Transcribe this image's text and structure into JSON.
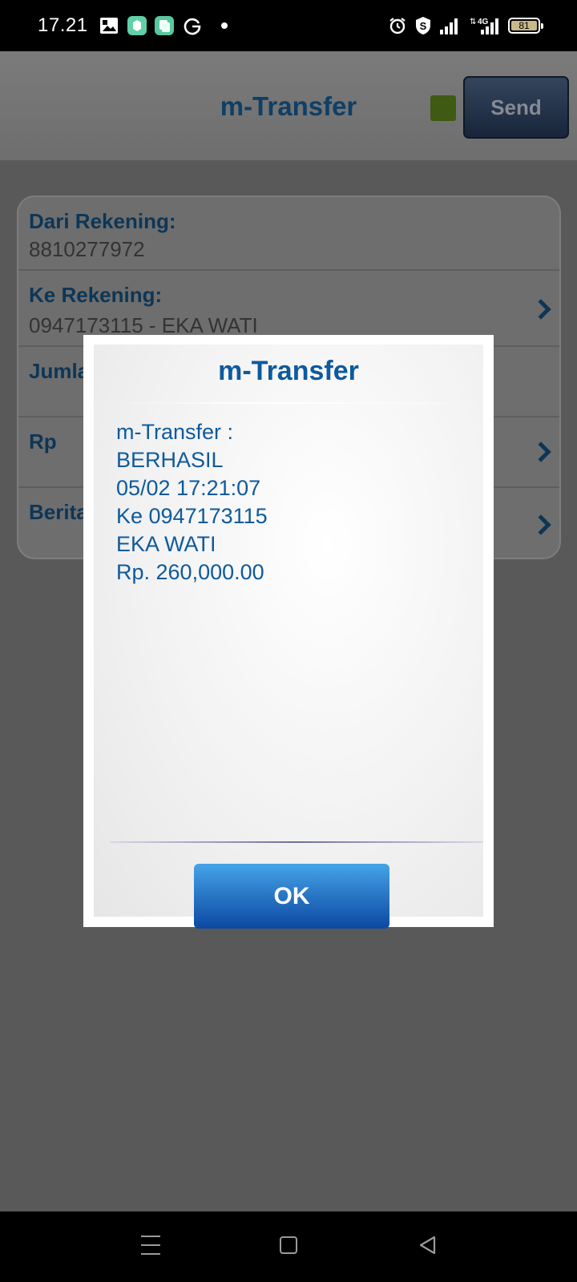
{
  "status_bar": {
    "time": "17.21",
    "network": "4G",
    "battery": "81",
    "icons": [
      "gallery-icon",
      "app-icon",
      "copy-icon",
      "g-icon",
      "dot-icon",
      "alarm-icon",
      "shield-s-icon",
      "signal-icon",
      "data-signal-icon",
      "battery-icon"
    ]
  },
  "header": {
    "title": "m-Transfer",
    "send_label": "Send",
    "status_color": "#3f5a12"
  },
  "form": {
    "rows": [
      {
        "label": "Dari Rekening:",
        "value": "8810277972"
      },
      {
        "label": "Ke Rekening:",
        "value": "0947173115 - EKA WATI"
      },
      {
        "label": "Jumla",
        "value": ""
      },
      {
        "label": "Rp",
        "value": ""
      },
      {
        "label": "Berita",
        "value": ""
      }
    ]
  },
  "dialog": {
    "title": "m-Transfer",
    "lines": [
      "m-Transfer :",
      "BERHASIL",
      "05/02 17:21:07",
      "Ke 0947173115",
      "EKA WATI",
      "Rp. 260,000.00"
    ],
    "ok_label": "OK"
  },
  "colors": {
    "accent_blue": "#0e5a9c",
    "dim_overlay": "#595959"
  }
}
